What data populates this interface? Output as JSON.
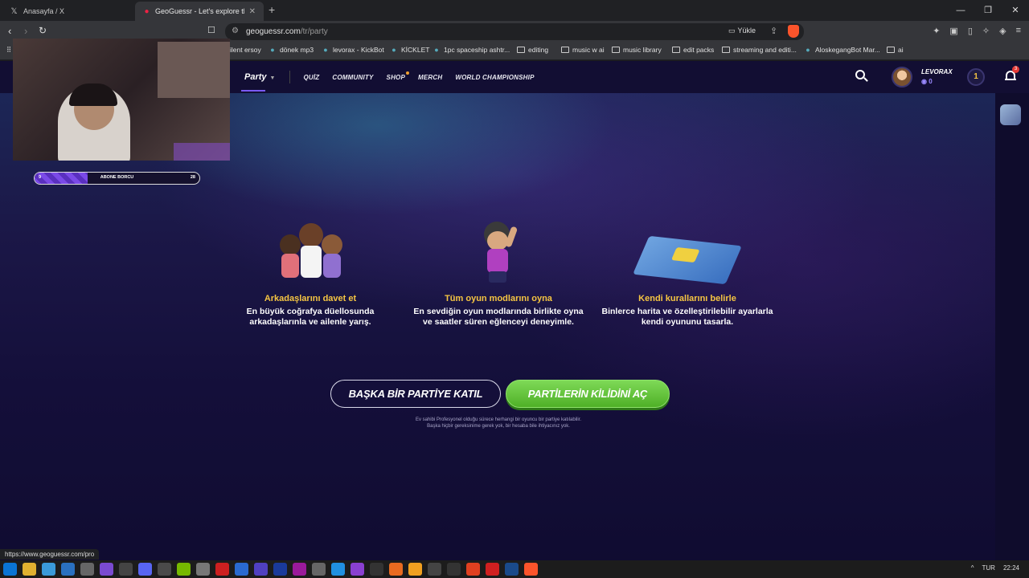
{
  "tabs": [
    {
      "title": "Anasayfa / X",
      "icon": "x-logo-icon"
    },
    {
      "title": "GeoGuessr - Let's explore the w...",
      "icon": "geoguessr-pin-icon"
    }
  ],
  "address": {
    "domain": "geoguessr.com",
    "path": "/tr/party",
    "yukle_label": "Yükle"
  },
  "bookmarks": [
    {
      "label": "ilent ersoy",
      "icon": ""
    },
    {
      "label": "dönek mp3",
      "icon": "app-icon"
    },
    {
      "label": "levorax - KickBot",
      "icon": "kickbot-icon"
    },
    {
      "label": "KİCKLET",
      "icon": "kicklet-icon"
    },
    {
      "label": "1pc spaceship ashtr...",
      "icon": "aliexpress-icon"
    },
    {
      "label": "editing",
      "icon": "folder-icon"
    },
    {
      "label": "music w ai",
      "icon": "folder-icon"
    },
    {
      "label": "music library",
      "icon": "folder-icon"
    },
    {
      "label": "edit packs",
      "icon": "folder-icon"
    },
    {
      "label": "streaming and editi...",
      "icon": "folder-icon"
    },
    {
      "label": "AloskegangBot Mar...",
      "icon": "chrome-icon"
    },
    {
      "label": "ai",
      "icon": "folder-icon"
    }
  ],
  "site_nav": {
    "party": "Party",
    "links": [
      "QUİZ",
      "COMMUNITY",
      "SHOP",
      "MERCH",
      "WORLD CHAMPIONSHIP"
    ]
  },
  "user": {
    "name": "LEVORAX",
    "coins": "0",
    "level": "1",
    "notifications": "3"
  },
  "features": [
    {
      "title": "Arkadaşlarını davet et",
      "desc_line1": "En büyük coğrafya düellosunda",
      "desc_line2": "arkadaşlarınla ve ailenle yarış."
    },
    {
      "title": "Tüm oyun modlarını oyna",
      "desc_line1": "En sevdiğin oyun modlarında birlikte oyna",
      "desc_line2": "ve saatler süren eğlenceyi deneyimle."
    },
    {
      "title": "Kendi kurallarını belirle",
      "desc_line1": "Binlerce harita ve özelleştirilebilir ayarlarla",
      "desc_line2": "kendi oyununu tasarla."
    }
  ],
  "buttons": {
    "join": "BAŞKA BİR PARTİYE KATIL",
    "unlock": "PARTİLERİN KİLİDİNİ AÇ"
  },
  "note": "Ev sahibi Profesyonel olduğu sürece herhangi bir oyuncu bir partiye katılabilir. Başka hiçbir gereksinime gerek yok, bir hesaba bile ihtiyacınız yok.",
  "sub_goal": {
    "label": "ABONE BORCU",
    "current": "9",
    "target": "28",
    "progress": 0.32
  },
  "status_url": "https://www.geoguessr.com/pro",
  "tray": {
    "lang": "TUR",
    "time": "22:24"
  },
  "colors": {
    "accent_yellow": "#f5c542",
    "green_button": "#5cc230",
    "purple": "#7a5af5"
  }
}
